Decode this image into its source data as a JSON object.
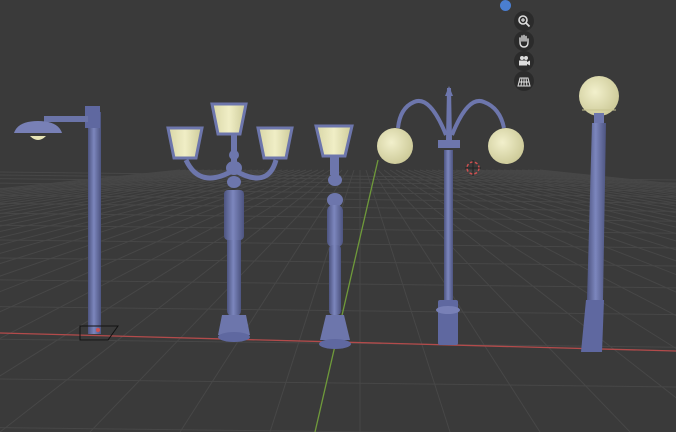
{
  "viewport": {
    "colors": {
      "background": "#3a3a3a",
      "grid": "#4a4a4a",
      "x_axis": "#b34b4b",
      "y_axis": "#6f9a3a",
      "mesh": "#6b74a8",
      "mesh_shadow": "#4d5480",
      "glass": "#e4e2b4",
      "gizmo_blue": "#4a7ed0"
    },
    "navigation": [
      {
        "name": "zoom-icon"
      },
      {
        "name": "hand-pan-icon"
      },
      {
        "name": "camera-icon"
      },
      {
        "name": "perspective-grid-icon"
      }
    ],
    "objects": [
      {
        "name": "cobra-head-streetlight"
      },
      {
        "name": "triple-lantern-lamppost"
      },
      {
        "name": "single-lantern-lamppost"
      },
      {
        "name": "double-globe-lamppost"
      },
      {
        "name": "single-globe-lamppost"
      }
    ]
  }
}
